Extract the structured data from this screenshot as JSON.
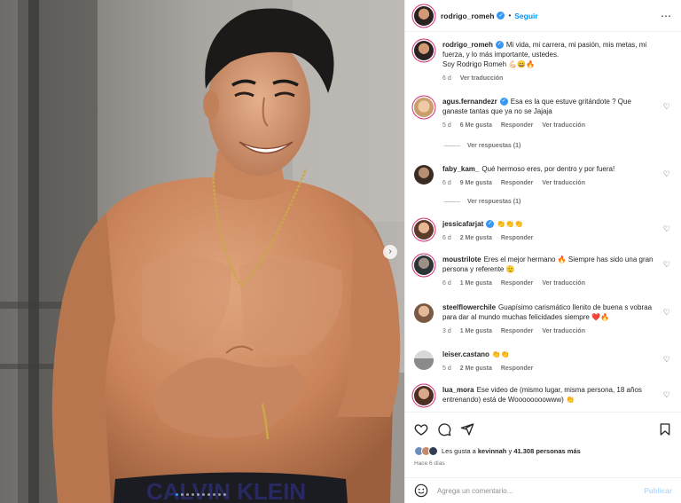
{
  "header": {
    "username": "rodrigo_romeh",
    "separator": "•",
    "follow_label": "Seguir",
    "more_icon": "⋯"
  },
  "caption": {
    "username": "rodrigo_romeh",
    "line1": "Mi vida, mi carrera, mi pasión, mis metas, mi fuerza, y lo más importante, ustedes.",
    "line2": "Soy Rodrigo Romeh 💪🏻😄🔥",
    "time": "6 d",
    "translate": "Ver traducción"
  },
  "comments": [
    {
      "username": "agus.fernandezr",
      "verified": true,
      "text": "Esa es la que estuve gritándote ? Que ganaste tantas que ya no se Jajaja",
      "time": "5 d",
      "likes": "6 Me gusta",
      "reply": "Responder",
      "translate": "Ver traducción",
      "replies": "Ver respuestas (1)"
    },
    {
      "username": "faby_kam_",
      "verified": false,
      "text": "Qué hermoso eres, por dentro y por fuera!",
      "time": "6 d",
      "likes": "9 Me gusta",
      "reply": "Responder",
      "translate": "Ver traducción",
      "replies": "Ver respuestas (1)"
    },
    {
      "username": "jessicafarjat",
      "verified": true,
      "text": "👏👏👏",
      "time": "6 d",
      "likes": "2 Me gusta",
      "reply": "Responder",
      "translate": ""
    },
    {
      "username": "moustrilote",
      "verified": false,
      "text": "Eres el mejor hermano 🔥 Siempre has sido una gran persona y referente 🫡",
      "time": "6 d",
      "likes": "1 Me gusta",
      "reply": "Responder",
      "translate": "Ver traducción"
    },
    {
      "username": "steelflowerchile",
      "verified": false,
      "text": "Guapísimo carismático llenito de buena s vobraa para dar al mundo muchas felicidades siempre ❤️🔥",
      "time": "3 d",
      "likes": "1 Me gusta",
      "reply": "Responder",
      "translate": "Ver traducción"
    },
    {
      "username": "leiser.castano",
      "verified": false,
      "text": "👏👏",
      "time": "5 d",
      "likes": "2 Me gusta",
      "reply": "Responder",
      "translate": ""
    },
    {
      "username": "lua_mora",
      "verified": false,
      "text": "Ese video de (mismo lugar, misma persona, 18 años entrenando) está de Woooooooowww) 👏",
      "time": "",
      "likes": "",
      "reply": "",
      "translate": ""
    }
  ],
  "likes_line": {
    "prefix": "Les gusta a",
    "user": "kevinnah",
    "joiner": "y",
    "count": "41.308 personas más"
  },
  "time_ago": "Hace 6 días",
  "add_comment": {
    "placeholder": "Agrega un comentario...",
    "post_label": "Publicar"
  },
  "carousel": {
    "current": 1,
    "total": 10
  },
  "colors": {
    "accent": "#0095f6",
    "verified": "#3897f0",
    "muted": "#737373"
  }
}
